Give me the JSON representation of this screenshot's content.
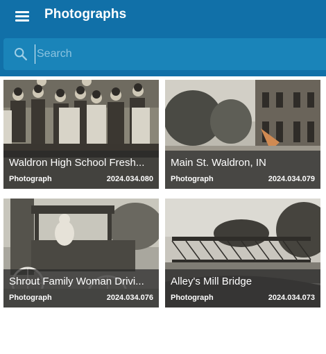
{
  "header": {
    "menu_icon": "hamburger-menu-icon",
    "title": "Photographs"
  },
  "search": {
    "icon": "search-icon",
    "placeholder": "Search",
    "value": ""
  },
  "colors": {
    "appbar": "#1170a8",
    "searchbar": "#1a84b9",
    "caption_overlay": "rgba(40,40,40,0.72)"
  },
  "cards": [
    {
      "title": "Waldron High School Fresh...",
      "type": "Photograph",
      "id": "2024.034.080"
    },
    {
      "title": "Main St. Waldron, IN",
      "type": "Photograph",
      "id": "2024.034.079"
    },
    {
      "title": "Shrout Family Woman Drivi...",
      "type": "Photograph",
      "id": "2024.034.076"
    },
    {
      "title": "Alley's Mill Bridge",
      "type": "Photograph",
      "id": "2024.034.073"
    }
  ]
}
